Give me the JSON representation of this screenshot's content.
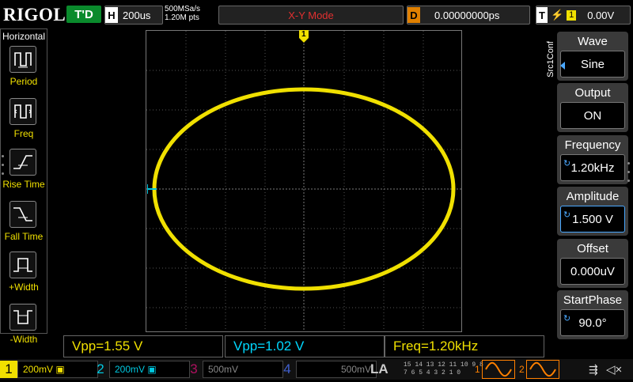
{
  "top": {
    "logo": "RIGOL",
    "trig_state": "T'D",
    "horizontal_tag": "H",
    "horizontal_scale": "200us",
    "sample_rate": "500MSa/s",
    "memory_depth": "1.20M pts",
    "mode": "X-Y Mode",
    "delay_tag": "D",
    "delay_value": "0.00000000ps",
    "trigger_tag": "T",
    "trigger_channel": "1",
    "trigger_level": "0.00V"
  },
  "left_panel": {
    "title": "Horizontal",
    "items": [
      {
        "label": "Period",
        "icon": "period-icon"
      },
      {
        "label": "Freq",
        "icon": "freq-icon"
      },
      {
        "label": "Rise Time",
        "icon": "rise-time-icon"
      },
      {
        "label": "Fall Time",
        "icon": "fall-time-icon"
      },
      {
        "label": "+Width",
        "icon": "pos-width-icon"
      },
      {
        "label": "-Width",
        "icon": "neg-width-icon"
      }
    ]
  },
  "trigger_marker": "1",
  "right_panel": {
    "side_label": "Src1Conf",
    "items": [
      {
        "label": "Wave",
        "value": "Sine"
      },
      {
        "label": "Output",
        "value": "ON"
      },
      {
        "label": "Frequency",
        "value": "1.20kHz"
      },
      {
        "label": "Amplitude",
        "value": "1.500 V"
      },
      {
        "label": "Offset",
        "value": "0.000uV"
      },
      {
        "label": "StartPhase",
        "value": "90.0°"
      }
    ]
  },
  "measurements": [
    {
      "text": "Vpp=1.55 V",
      "color": "#f0e000"
    },
    {
      "text": "Vpp=1.02 V",
      "color": "#00d8ff"
    },
    {
      "text": "Freq=1.20kHz",
      "color": "#f0e000"
    }
  ],
  "channels": [
    {
      "num": "1",
      "value": "200mV",
      "color": "#f0e000",
      "active": true
    },
    {
      "num": "2",
      "value": "200mV",
      "color": "#00c8e0",
      "active": true
    },
    {
      "num": "3",
      "value": "500mV",
      "color": "#b01060",
      "active": false
    },
    {
      "num": "4",
      "value": "500mV",
      "color": "#4060d0",
      "active": false
    }
  ],
  "la": {
    "label": "LA",
    "bits_row1": "15 14 13 12 11 10 9 8",
    "bits_row2": "7 6 5 4 3 2 1 0"
  },
  "sources": [
    {
      "num": "1",
      "icon": "sine-wave-icon"
    },
    {
      "num": "2",
      "icon": "sine-wave-icon"
    }
  ],
  "colors": {
    "ch1": "#f0e000",
    "ch2": "#00c8e0",
    "accent": "#ff8000"
  }
}
